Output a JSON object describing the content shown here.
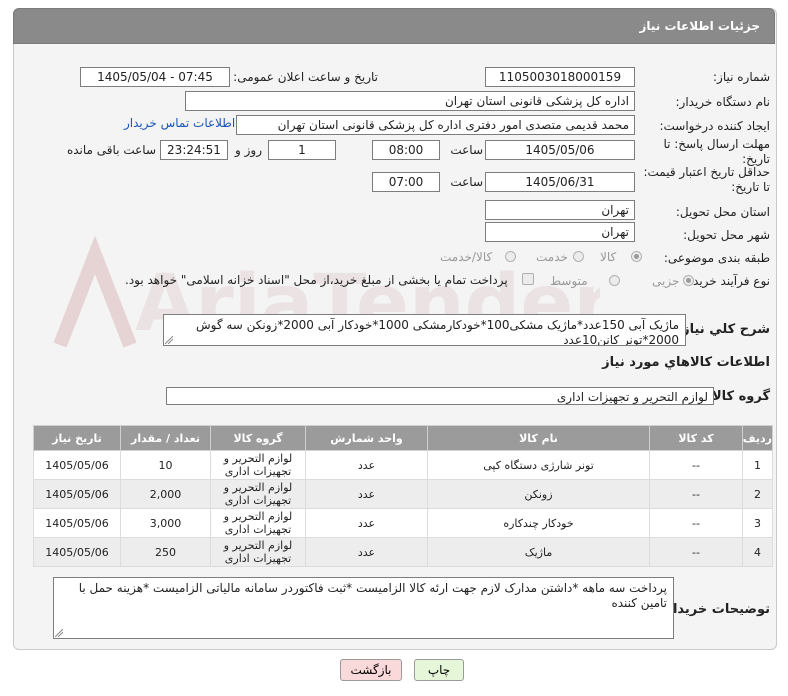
{
  "page": {
    "title": "جزئیات اطلاعات نیاز"
  },
  "form": {
    "need_number_label": "شماره نیاز:",
    "need_number": "1105003018000159",
    "announce_label": "تاریخ و ساعت اعلان عمومی:",
    "announce_value": "1405/05/04 - 07:45",
    "buyer_org_label": "نام دستگاه خریدار:",
    "buyer_org": "اداره کل پزشکی قانونی استان تهران",
    "creator_label": "ایجاد کننده درخواست:",
    "creator": "محمد قدیمی متصدی امور دفتری اداره کل پزشکی قانونی استان تهران",
    "contact_link": "اطلاعات تماس خریدار",
    "deadline_label_1": "مهلت ارسال پاسخ: تا",
    "deadline_label_2": "تاریخ:",
    "deadline_date": "1405/05/06",
    "time_label": "ساعت",
    "deadline_time": "08:00",
    "days_value": "1",
    "days_label": "روز و",
    "remaining_time": "23:24:51",
    "remaining_label": "ساعت باقی مانده",
    "validity_label_1": "حداقل تاریخ اعتبار قیمت:",
    "validity_label_2": "تا تاریخ:",
    "validity_date": "1405/06/31",
    "validity_time": "07:00",
    "province_label": "استان محل تحویل:",
    "province": "تهران",
    "city_label": "شهر محل تحویل:",
    "city": "تهران",
    "category_label": "طبقه بندی موضوعی:",
    "category_options": [
      "کالا",
      "خدمت",
      "کالا/خدمت"
    ],
    "category_selected": "کالا",
    "process_label": "نوع فرآیند خرید :",
    "process_options": [
      "جزیی",
      "متوسط"
    ],
    "process_selected": "جزیی",
    "payment_note": "پرداخت تمام یا بخشی از مبلغ خرید،از محل \"اسناد خزانه اسلامی\" خواهد بود.",
    "summary_label": "شرح کلي نياز:",
    "summary": "ماژیک آبی 150عدد*ماژیک مشکی100*خودکارمشکی 1000*خودکار آبی 2000*زونکن سه گوش 2000*تونر کانن10عدد",
    "goods_info_title": "اطلاعات کالاهاي مورد نياز",
    "goods_group_label": "گروه کالا:",
    "goods_group": "لوازم التحریر و تجهیزات اداری",
    "buyer_notes_label": "توضیحات خریدار:",
    "buyer_notes": "پرداخت سه ماهه *داشتن مدارک لازم جهت ارئه کالا الزامیست *ثبت فاکتوردر سامانه مالیاتی الزامیست *هزینه حمل با تامین کننده"
  },
  "watermark": {
    "text": "AriaTender.net"
  },
  "table": {
    "headers": [
      "ردیف",
      "کد کالا",
      "نام کالا",
      "واحد شمارش",
      "گروه کالا",
      "تعداد / مقدار",
      "تاریخ نیاز"
    ],
    "rows": [
      [
        "1",
        "--",
        "تونر شارژی دستگاه کپی",
        "عدد",
        "لوازم التحریر و تجهیزات اداری",
        "10",
        "1405/05/06"
      ],
      [
        "2",
        "--",
        "زونکن",
        "عدد",
        "لوازم التحریر و تجهیزات اداری",
        "2,000",
        "1405/05/06"
      ],
      [
        "3",
        "--",
        "خودکار چندکاره",
        "عدد",
        "لوازم التحریر و تجهیزات اداری",
        "3,000",
        "1405/05/06"
      ],
      [
        "4",
        "--",
        "ماژیک",
        "عدد",
        "لوازم التحریر و تجهیزات اداری",
        "250",
        "1405/05/06"
      ]
    ]
  },
  "buttons": {
    "print": "چاپ",
    "back": "بازگشت"
  },
  "colors": {
    "header_bg": "#8a8a8a",
    "table_header_bg": "#9b9b9b",
    "link": "#1a55b8",
    "back_btn": "#f9d9d9",
    "print_btn": "#e6f7d9"
  }
}
